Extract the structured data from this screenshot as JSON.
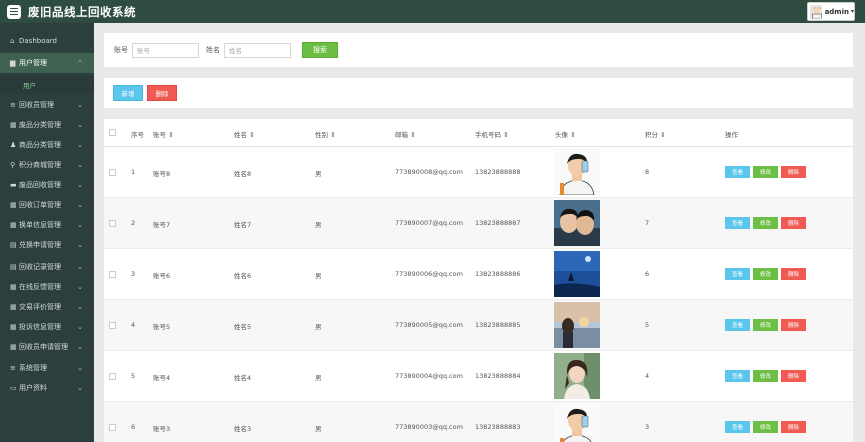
{
  "app": {
    "title": "废旧品线上回收系统"
  },
  "user": {
    "name": "admin",
    "caret": "▾"
  },
  "sidebar": {
    "items": [
      {
        "label": "Dashboard",
        "icon": "home-icon",
        "glyph": "⌂",
        "has_chevron": false,
        "active": false
      },
      {
        "label": "用户管理",
        "icon": "user-icon",
        "glyph": "▆",
        "has_chevron": true,
        "active": true,
        "chevron": "⌃"
      },
      {
        "label": "回收员管理",
        "icon": "list-icon",
        "glyph": "≡",
        "has_chevron": true,
        "chevron": "⌄"
      },
      {
        "label": "废品分类管理",
        "icon": "grid-icon",
        "glyph": "▦",
        "has_chevron": true,
        "chevron": "⌄"
      },
      {
        "label": "商品分类管理",
        "icon": "person-icon",
        "glyph": "♟",
        "has_chevron": true,
        "chevron": "⌄"
      },
      {
        "label": "积分商城管理",
        "icon": "cart-icon",
        "glyph": "⚲",
        "has_chevron": true,
        "chevron": "⌄"
      },
      {
        "label": "废品回收管理",
        "icon": "monitor-icon",
        "glyph": "▬",
        "has_chevron": true,
        "chevron": "⌄"
      },
      {
        "label": "回收订单管理",
        "icon": "grid-icon",
        "glyph": "▦",
        "has_chevron": true,
        "chevron": "⌄"
      },
      {
        "label": "换单信息管理",
        "icon": "grid-icon",
        "glyph": "▦",
        "has_chevron": true,
        "chevron": "⌄"
      },
      {
        "label": "兑换申请管理",
        "icon": "calendar-icon",
        "glyph": "▤",
        "has_chevron": true,
        "chevron": "⌄"
      },
      {
        "label": "回收记录管理",
        "icon": "calendar-icon",
        "glyph": "▤",
        "has_chevron": true,
        "chevron": "⌄"
      },
      {
        "label": "在线反馈管理",
        "icon": "grid-icon",
        "glyph": "▦",
        "has_chevron": true,
        "chevron": "⌄"
      },
      {
        "label": "交易评价管理",
        "icon": "grid-icon",
        "glyph": "▦",
        "has_chevron": true,
        "chevron": "⌄"
      },
      {
        "label": "投诉信息管理",
        "icon": "grid-icon",
        "glyph": "▦",
        "has_chevron": true,
        "chevron": "⌄"
      },
      {
        "label": "回收员申请管理",
        "icon": "grid-icon",
        "glyph": "▦",
        "has_chevron": true,
        "chevron": "⌄"
      },
      {
        "label": "系统管理",
        "icon": "list-icon",
        "glyph": "≡",
        "has_chevron": true,
        "chevron": "⌄"
      },
      {
        "label": "用户资料",
        "icon": "card-icon",
        "glyph": "▭",
        "has_chevron": true,
        "chevron": "⌄"
      }
    ],
    "sub_item": "用户"
  },
  "search": {
    "account_label": "账号",
    "account_placeholder": "账号",
    "name_label": "姓名",
    "name_placeholder": "姓名",
    "button": "搜索"
  },
  "actions": {
    "add": "新增",
    "delete": "删除"
  },
  "table": {
    "headers": [
      "序号",
      "账号 ⇕",
      "姓名 ⇕",
      "性别 ⇕",
      "邮箱 ⇕",
      "手机号码 ⇕",
      "头像 ⇕",
      "积分 ⇕",
      "操作"
    ],
    "op_labels": {
      "view": "查看",
      "edit": "修改",
      "delete": "删除"
    },
    "rows": [
      {
        "no": "1",
        "account": "账号8",
        "name": "姓名8",
        "gender": "男",
        "email": "773890008@qq.com",
        "phone": "13823888888",
        "points": "8",
        "photo": "man-cartoon"
      },
      {
        "no": "2",
        "account": "账号7",
        "name": "姓名7",
        "gender": "男",
        "email": "773890007@qq.com",
        "phone": "13823888887",
        "points": "7",
        "photo": "couple"
      },
      {
        "no": "3",
        "account": "账号6",
        "name": "姓名6",
        "gender": "男",
        "email": "773890006@qq.com",
        "phone": "13823888886",
        "points": "6",
        "photo": "night-sky"
      },
      {
        "no": "4",
        "account": "账号5",
        "name": "姓名5",
        "gender": "男",
        "email": "773890005@qq.com",
        "phone": "13823888885",
        "points": "5",
        "photo": "sunset"
      },
      {
        "no": "5",
        "account": "账号4",
        "name": "姓名4",
        "gender": "男",
        "email": "773890004@qq.com",
        "phone": "13823888884",
        "points": "4",
        "photo": "girl"
      },
      {
        "no": "6",
        "account": "账号3",
        "name": "姓名3",
        "gender": "男",
        "email": "773890003@qq.com",
        "phone": "13823888883",
        "points": "3",
        "photo": "man-cartoon"
      }
    ]
  },
  "colors": {
    "topbar": "#2e4c40",
    "sidebar": "#2c3e3d",
    "active": "#3f6250",
    "green": "#6cbe45",
    "blue": "#5ac6ec",
    "red": "#f05a52"
  }
}
